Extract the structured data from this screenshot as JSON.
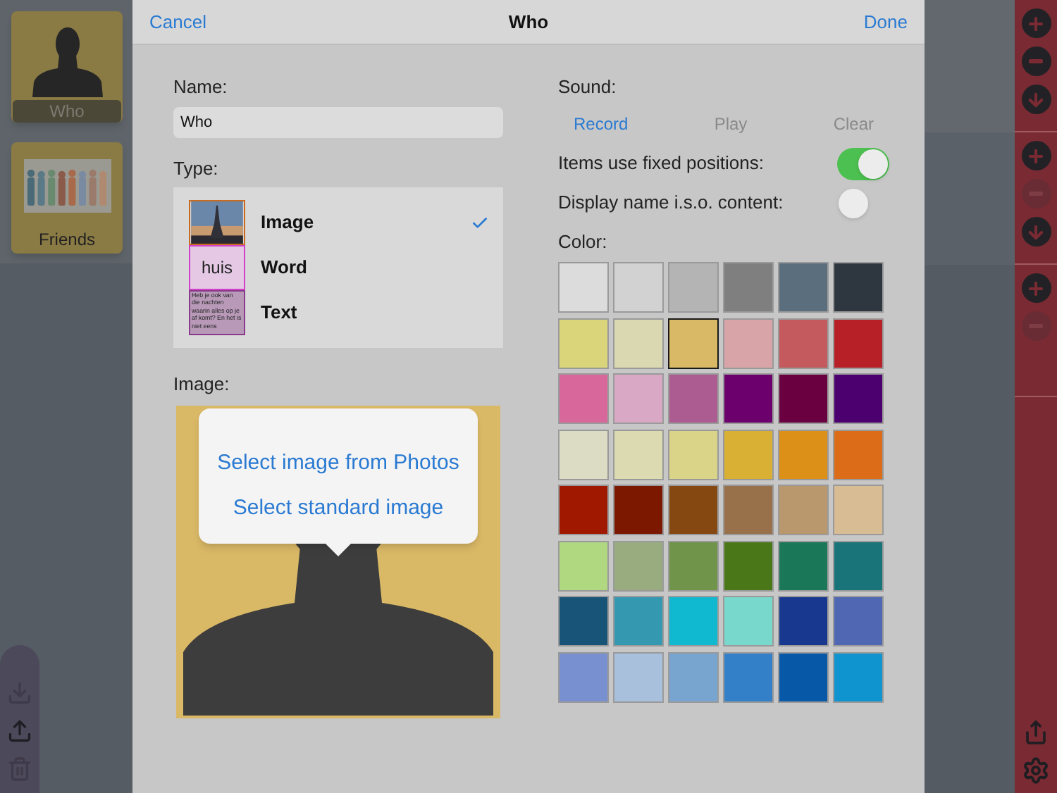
{
  "board": {
    "tiles": [
      {
        "kind": "icon",
        "label": "Who"
      },
      {
        "kind": "picture",
        "label": "Friends"
      }
    ],
    "file_actions": [
      {
        "kind": "import",
        "disabled": true
      },
      {
        "kind": "export",
        "disabled": false
      },
      {
        "kind": "delete",
        "disabled": true
      }
    ]
  },
  "sidebar": {
    "groups": [
      {
        "actions": [
          {
            "kind": "add",
            "disabled": false
          },
          {
            "kind": "remove",
            "disabled": false
          },
          {
            "kind": "down",
            "disabled": false
          }
        ]
      },
      {
        "actions": [
          {
            "kind": "add",
            "disabled": false
          },
          {
            "kind": "remove",
            "disabled": true
          },
          {
            "kind": "down",
            "disabled": false
          }
        ]
      },
      {
        "actions": [
          {
            "kind": "add",
            "disabled": false
          },
          {
            "kind": "remove",
            "disabled": true
          }
        ]
      }
    ],
    "bottom": [
      {
        "kind": "share"
      },
      {
        "kind": "settings"
      }
    ]
  },
  "dialog": {
    "cancel": "Cancel",
    "title": "Who",
    "done": "Done",
    "name_label": "Name:",
    "name_value": "Who",
    "type_label": "Type:",
    "types": [
      {
        "label": "Image",
        "selected": true
      },
      {
        "kind": "word",
        "label": "Word",
        "thumbnail": "huis",
        "selected": false
      },
      {
        "kind": "text",
        "label": "Text",
        "thumbnail": "Heb je ook van die nachten waarin alles op je af komt? En het is niet eens",
        "selected": false
      }
    ],
    "image_label": "Image:",
    "popover": {
      "items": [
        "Select image from Photos",
        "Select standard image"
      ]
    },
    "sound_label": "Sound:",
    "sound_buttons": [
      {
        "label": "Record",
        "disabled": false
      },
      {
        "label": "Play",
        "disabled": true
      },
      {
        "label": "Clear",
        "disabled": true
      }
    ],
    "toggles": [
      {
        "label": "Items use fixed positions:",
        "on": true
      },
      {
        "label": "Display name i.s.o. content:",
        "on": false
      }
    ],
    "color_label": "Color:",
    "colors": [
      {
        "color": "#dcdcdc",
        "selected": false
      },
      {
        "color": "#d2d2d2",
        "selected": false
      },
      {
        "color": "#b4b4b4",
        "selected": false
      },
      {
        "color": "#7f7f7f",
        "selected": false
      },
      {
        "color": "#5a6e7e",
        "selected": false
      },
      {
        "color": "#2e3740",
        "selected": false
      },
      {
        "color": "#dad47a",
        "selected": false
      },
      {
        "color": "#d9d8b0",
        "selected": false
      },
      {
        "color": "#d9b866",
        "selected": true
      },
      {
        "color": "#d9a4a8",
        "selected": false
      },
      {
        "color": "#c45a5e",
        "selected": false
      },
      {
        "color": "#b82028",
        "selected": false
      },
      {
        "color": "#d8689c",
        "selected": false
      },
      {
        "color": "#d8a8c4",
        "selected": false
      },
      {
        "color": "#ac5c90",
        "selected": false
      },
      {
        "color": "#6c006c",
        "selected": false
      },
      {
        "color": "#6a0040",
        "selected": false
      },
      {
        "color": "#4c0070",
        "selected": false
      },
      {
        "color": "#dcdcc4",
        "selected": false
      },
      {
        "color": "#dcdab0",
        "selected": false
      },
      {
        "color": "#dad488",
        "selected": false
      },
      {
        "color": "#dab034",
        "selected": false
      },
      {
        "color": "#dc9018",
        "selected": false
      },
      {
        "color": "#dc6c18",
        "selected": false
      },
      {
        "color": "#a01800",
        "selected": false
      },
      {
        "color": "#7c1800",
        "selected": false
      },
      {
        "color": "#844810",
        "selected": false
      },
      {
        "color": "#98704a",
        "selected": false
      },
      {
        "color": "#b8986c",
        "selected": false
      },
      {
        "color": "#d8bc94",
        "selected": false
      },
      {
        "color": "#b0d880",
        "selected": false
      },
      {
        "color": "#98ac80",
        "selected": false
      },
      {
        "color": "#70944a",
        "selected": false
      },
      {
        "color": "#4a7818",
        "selected": false
      },
      {
        "color": "#1a7858",
        "selected": false
      },
      {
        "color": "#187478",
        "selected": false
      },
      {
        "color": "#185478",
        "selected": false
      },
      {
        "color": "#3498b0",
        "selected": false
      },
      {
        "color": "#10b8d0",
        "selected": false
      },
      {
        "color": "#78d8cc",
        "selected": false
      },
      {
        "color": "#183890",
        "selected": false
      },
      {
        "color": "#5068b4",
        "selected": false
      },
      {
        "color": "#7890d0",
        "selected": false
      },
      {
        "color": "#a8c0dc",
        "selected": false
      },
      {
        "color": "#78a4d0",
        "selected": false
      },
      {
        "color": "#3480c8",
        "selected": false
      },
      {
        "color": "#0858a8",
        "selected": false
      },
      {
        "color": "#1094d0",
        "selected": false
      }
    ]
  }
}
